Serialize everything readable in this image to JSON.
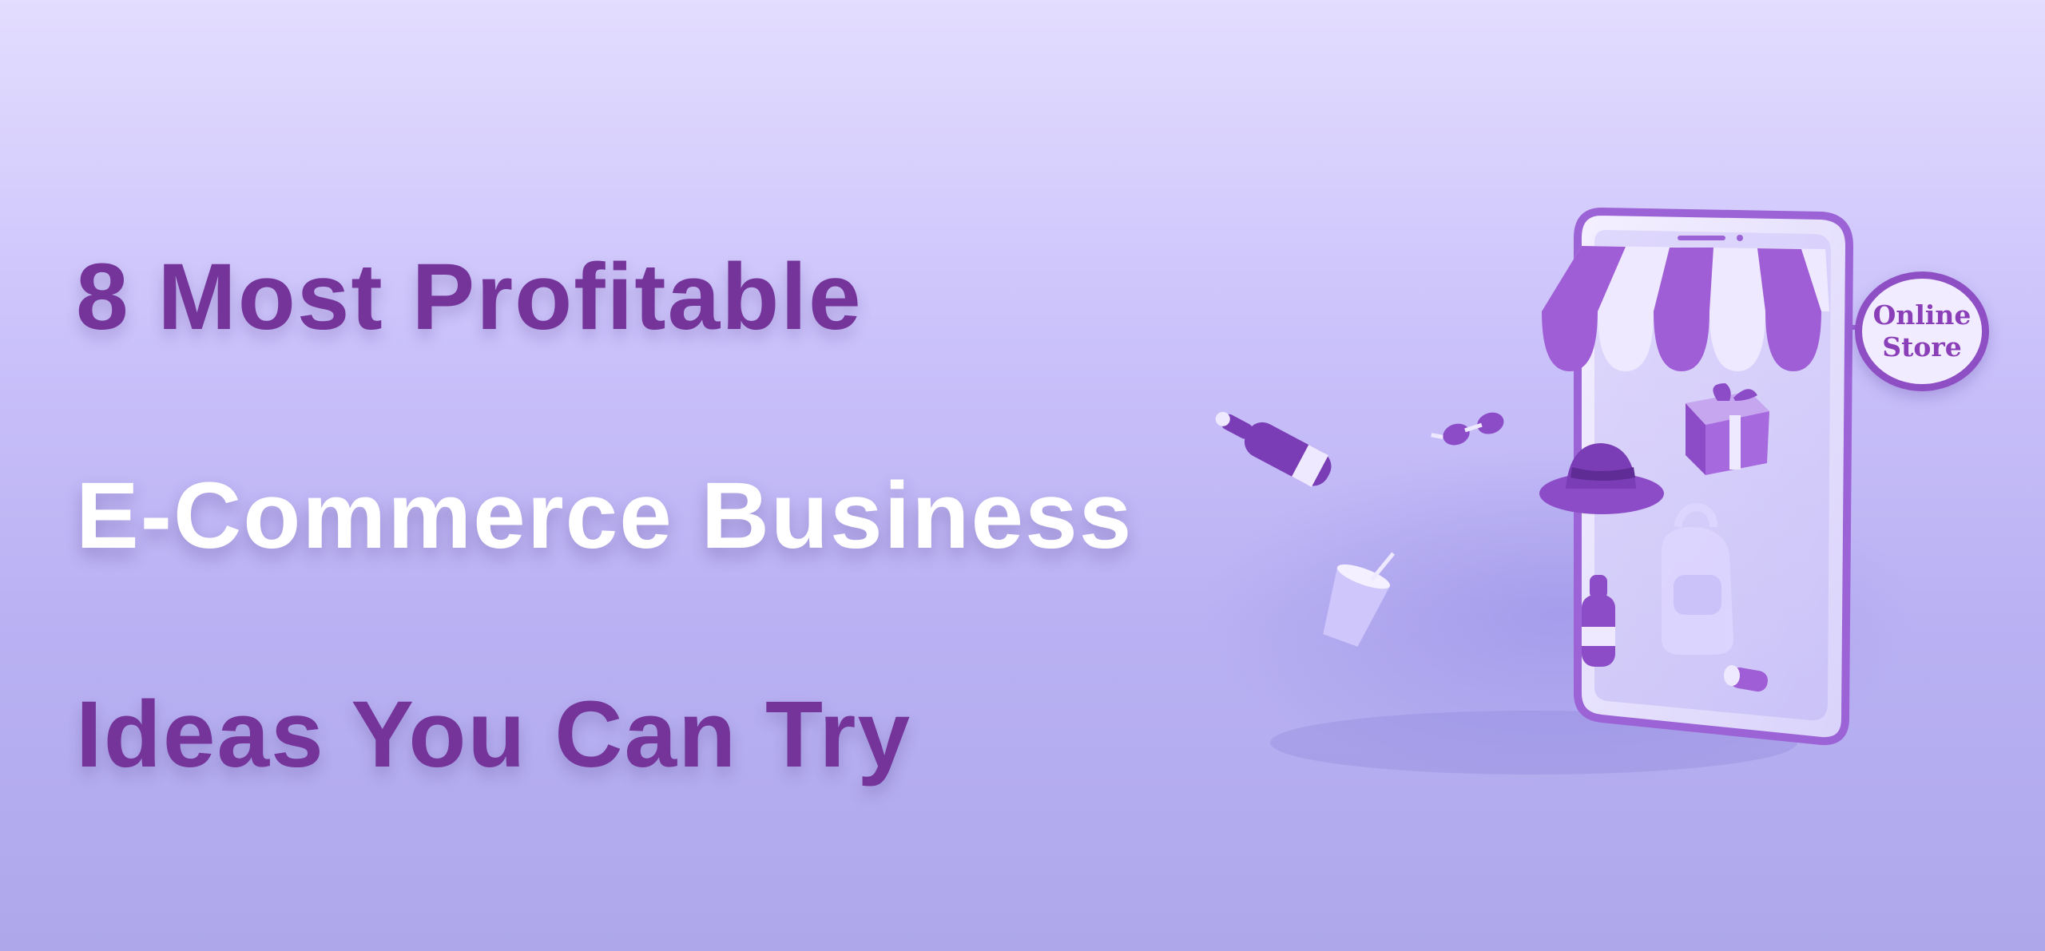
{
  "headline": {
    "line_1": "8 Most Profitable",
    "line_2": "E-Commerce Business",
    "line_3": "Ideas You Can Try"
  },
  "store_sign": {
    "line_1": "Online",
    "line_2": "Store"
  },
  "colors": {
    "headline_purple": "#74349a",
    "headline_white": "#ffffff",
    "background_top": "#e3ddfe",
    "background_bottom": "#aea8eb",
    "accent_purple": "#8f4fc4"
  },
  "icons": [
    "smartphone-storefront-illustration",
    "striped-awning",
    "gift-box-icon",
    "wine-bottle-icon",
    "sunglasses-icon",
    "hat-icon",
    "cup-icon",
    "backpack-icon",
    "bottle-icon",
    "lipstick-icon"
  ]
}
